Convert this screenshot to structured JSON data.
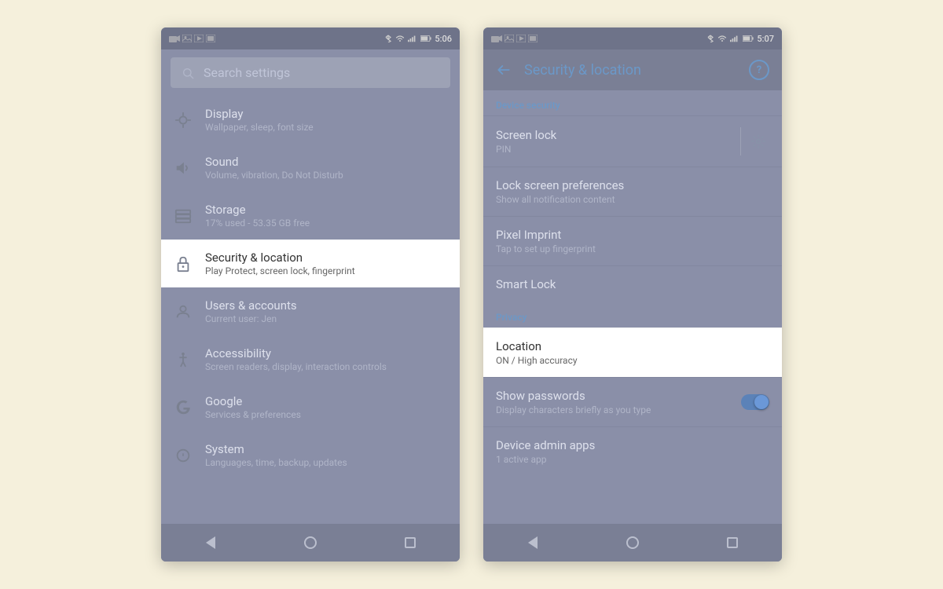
{
  "left_phone": {
    "status_bar": {
      "time": "5:06"
    },
    "search": {
      "placeholder": "Search settings"
    },
    "settings_items": [
      {
        "id": "display",
        "title": "Display",
        "subtitle": "Wallpaper, sleep, font size",
        "active": false
      },
      {
        "id": "sound",
        "title": "Sound",
        "subtitle": "Volume, vibration, Do Not Disturb",
        "active": false
      },
      {
        "id": "storage",
        "title": "Storage",
        "subtitle": "17% used - 53.35 GB free",
        "active": false
      },
      {
        "id": "security",
        "title": "Security & location",
        "subtitle": "Play Protect, screen lock, fingerprint",
        "active": true
      },
      {
        "id": "users",
        "title": "Users & accounts",
        "subtitle": "Current user: Jen",
        "active": false
      },
      {
        "id": "accessibility",
        "title": "Accessibility",
        "subtitle": "Screen readers, display, interaction controls",
        "active": false
      },
      {
        "id": "google",
        "title": "Google",
        "subtitle": "Services & preferences",
        "active": false
      },
      {
        "id": "system",
        "title": "System",
        "subtitle": "Languages, time, backup, updates",
        "active": false
      }
    ],
    "nav": {
      "back_label": "back",
      "home_label": "home",
      "recents_label": "recents"
    }
  },
  "right_phone": {
    "status_bar": {
      "time": "5:07"
    },
    "header": {
      "title": "Security & location",
      "help_label": "?"
    },
    "sections": [
      {
        "label": "Device security",
        "items": [
          {
            "id": "screen-lock",
            "title": "Screen lock",
            "subtitle": "PIN",
            "has_gear": true,
            "active": false
          },
          {
            "id": "lock-screen-prefs",
            "title": "Lock screen preferences",
            "subtitle": "Show all notification content",
            "has_gear": false,
            "active": false
          },
          {
            "id": "pixel-imprint",
            "title": "Pixel Imprint",
            "subtitle": "Tap to set up fingerprint",
            "has_gear": false,
            "active": false
          },
          {
            "id": "smart-lock",
            "title": "Smart Lock",
            "subtitle": "",
            "has_gear": false,
            "active": false
          }
        ]
      },
      {
        "label": "Privacy",
        "items": [
          {
            "id": "location",
            "title": "Location",
            "subtitle": "ON / High accuracy",
            "has_gear": false,
            "active": true
          },
          {
            "id": "show-passwords",
            "title": "Show passwords",
            "subtitle": "Display characters briefly as you type",
            "has_gear": false,
            "has_toggle": true,
            "active": false
          },
          {
            "id": "device-admin-apps",
            "title": "Device admin apps",
            "subtitle": "1 active app",
            "has_gear": false,
            "active": false
          }
        ]
      }
    ],
    "nav": {
      "back_label": "back",
      "home_label": "home",
      "recents_label": "recents"
    }
  }
}
